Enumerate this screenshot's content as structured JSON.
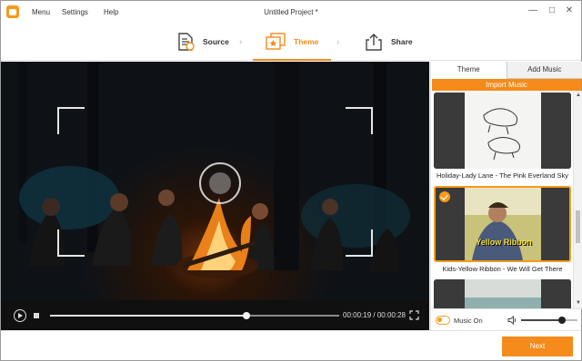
{
  "titlebar": {
    "menus": [
      "Menu",
      "Settings",
      "Help"
    ],
    "title": "Untitled Project *",
    "controls": [
      "minimize",
      "maximize",
      "close"
    ]
  },
  "steps": [
    {
      "label": "Source",
      "icon": "source-document-icon",
      "active": false
    },
    {
      "label": "Theme",
      "icon": "theme-images-icon",
      "active": true
    },
    {
      "label": "Share",
      "icon": "share-upload-icon",
      "active": false
    }
  ],
  "player": {
    "current_time": "00:00:19",
    "separator": "/",
    "total_time": "00:00:28",
    "progress": 0.68
  },
  "panel": {
    "tabs": [
      {
        "label": "Theme",
        "active": true
      },
      {
        "label": "Add Music",
        "active": false
      }
    ],
    "import_label": "Import Music",
    "themes": [
      {
        "label": "Holiday-Lady Lane - The Pink Everland Sky",
        "selected": false
      },
      {
        "label": "Kids-Yellow Ribbon - We Will Get There",
        "selected": true,
        "thumb_text": "Yellow Ribbon"
      },
      {
        "label": "",
        "selected": false
      }
    ],
    "music_label": "Music On",
    "music_on": false,
    "volume": 0.72
  },
  "footer": {
    "next_label": "Next"
  },
  "colors": {
    "accent": "#f58b1a",
    "video_bg": "#0e1217",
    "control_bar": "#101010"
  }
}
